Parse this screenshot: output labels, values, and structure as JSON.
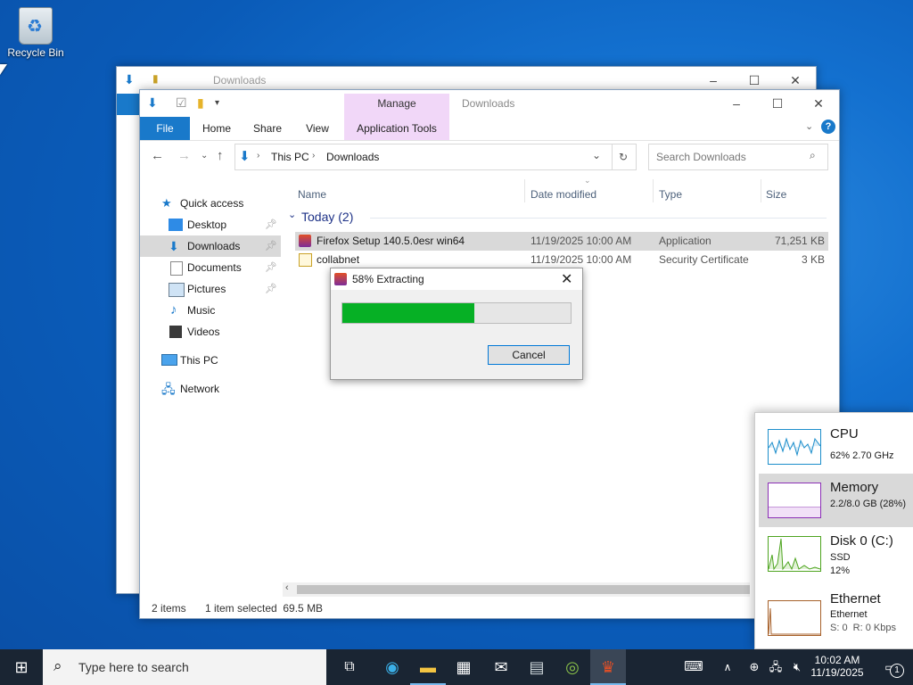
{
  "desktop": {
    "recycle_bin_label": "Recycle Bin"
  },
  "back_window": {
    "title": "Downloads"
  },
  "explorer": {
    "title": "Downloads",
    "context_tab_group": "Manage",
    "tabs": [
      "File",
      "Home",
      "Share",
      "View",
      "Application Tools"
    ],
    "address": {
      "segments": [
        "This PC",
        "Downloads"
      ]
    },
    "search_placeholder": "Search Downloads",
    "nav": [
      {
        "label": "Quick access"
      },
      {
        "label": "Desktop",
        "pinned": true
      },
      {
        "label": "Downloads",
        "pinned": true,
        "selected": true
      },
      {
        "label": "Documents",
        "pinned": true
      },
      {
        "label": "Pictures",
        "pinned": true
      },
      {
        "label": "Music"
      },
      {
        "label": "Videos"
      },
      {
        "label": "This PC"
      },
      {
        "label": "Network"
      }
    ],
    "columns": [
      "Name",
      "Date modified",
      "Type",
      "Size"
    ],
    "group_label": "Today (2)",
    "files": [
      {
        "name": "Firefox Setup 140.5.0esr win64",
        "date": "11/19/2025 10:00 AM",
        "type": "Application",
        "size": "71,251 KB",
        "selected": true
      },
      {
        "name": "collabnet",
        "date": "11/19/2025 10:00 AM",
        "type": "Security Certificate",
        "size": "3 KB"
      }
    ],
    "status": {
      "items": "2 items",
      "selection": "1 item selected  69.5 MB"
    }
  },
  "dialog": {
    "title": "58% Extracting",
    "progress": 0.58,
    "cancel_label": "Cancel"
  },
  "task_manager": {
    "items": [
      {
        "name": "CPU",
        "detail1": "62%  2.70 GHz",
        "color": "#1c8ecb"
      },
      {
        "name": "Memory",
        "detail1": "2.2/8.0 GB (28%)",
        "color": "#8b2fb5",
        "selected": true
      },
      {
        "name": "Disk 0 (C:)",
        "detail1": "SSD",
        "detail2": "12%",
        "color": "#4da41f"
      },
      {
        "name": "Ethernet",
        "detail1": "Ethernet",
        "detail2": "S: 0  R: 0 Kbps",
        "color": "#a7612b"
      }
    ]
  },
  "taskbar": {
    "search_placeholder": "Type here to search",
    "clock_time": "10:02 AM",
    "clock_date": "11/19/2025",
    "notification_count": "1"
  },
  "colors": {
    "accent": "#0078d7",
    "progress": "#06b025",
    "file_tab": "#1979ca"
  }
}
